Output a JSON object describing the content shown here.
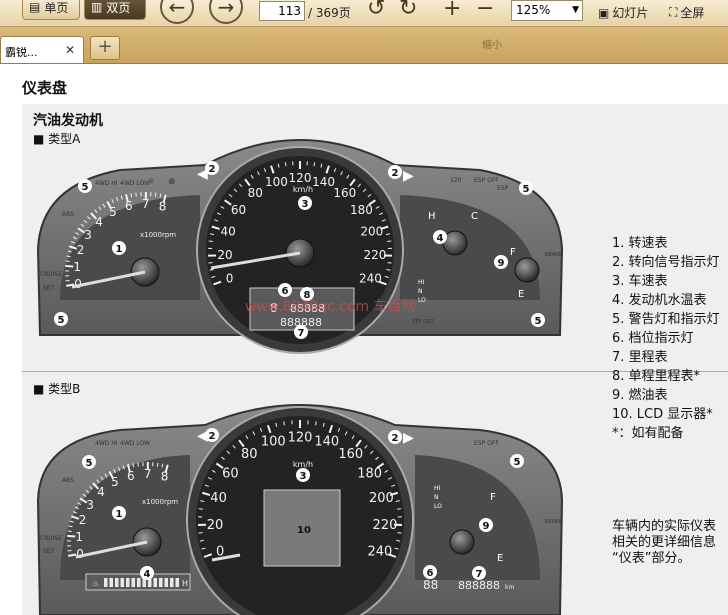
{
  "toolbar": {
    "single_page": "单页",
    "double_page": "双页",
    "page_current": "113",
    "page_total": "/ 369页",
    "zoom": "125%",
    "slideshow": "幻灯片",
    "fullscreen": "全屏"
  },
  "tabs": [
    {
      "label": "霸锐..."
    }
  ],
  "watermark_small": "缩小",
  "doc": {
    "title": "仪表盘",
    "subtitle": "汽油发动机",
    "type_a": "■ 类型A",
    "type_b": "■ 类型B"
  },
  "legend": [
    "1. 转速表",
    "2. 转向信号指示灯",
    "3. 车速表",
    "4. 发动机水温表",
    "5. 警告灯和指示灯",
    "6. 档位指示灯",
    "7. 里程表",
    "8. 单程里程表*",
    "9. 燃油表",
    "10. LCD 显示器*",
    "*：如有配备"
  ],
  "note": [
    "车辆内的实际仪表",
    "相关的更详细信息",
    "“仪表”部分。"
  ],
  "watermark": "www.8848qc.com 车百网",
  "gauges": {
    "speedo_ticks": [
      "0",
      "20",
      "40",
      "60",
      "80",
      "100",
      "120",
      "140",
      "160",
      "180",
      "200",
      "220",
      "240"
    ],
    "speedo_unit": "km/h",
    "tacho_ticks": [
      "0",
      "1",
      "2",
      "3",
      "4",
      "5",
      "6",
      "7",
      "8"
    ],
    "tacho_unit": "x1000rpm",
    "odo_a": "888888",
    "odo_b": "888888",
    "odo_unit": "km",
    "lcd_a": "88888",
    "fuel_f": "F",
    "fuel_e": "E",
    "temp_h": "H",
    "temp_c": "C",
    "temp_bar_h": "H",
    "gear": "8",
    "gear_b": "88",
    "callouts": [
      "1",
      "2",
      "3",
      "4",
      "5",
      "6",
      "7",
      "8",
      "9",
      "10"
    ],
    "icon_labels": {
      "4wd_hi": "4WD HI",
      "4wd_low": "4WD LOW",
      "esp_off": "ESP OFF",
      "esp": "ESP",
      "cruise": "CRUISE",
      "set": "SET",
      "brake": "BRAKE",
      "hi": "HI",
      "n": "N",
      "lo": "LO",
      "speed120": "120",
      "kmh": "km/h",
      "abs": "ABS",
      "key_out": "KEY OUT"
    }
  }
}
